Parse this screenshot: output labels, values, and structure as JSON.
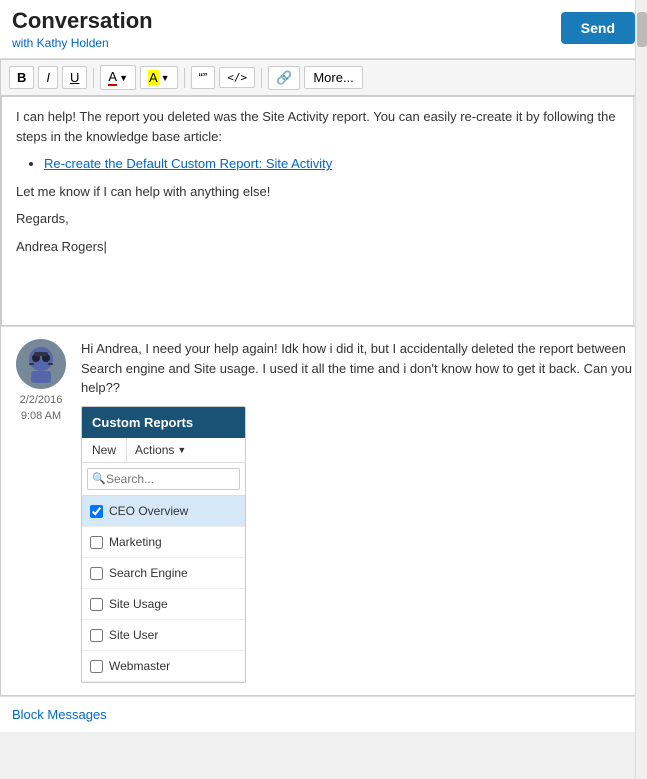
{
  "header": {
    "title": "Conversation",
    "subtitle": "with Kathy Holden",
    "send_label": "Send"
  },
  "toolbar": {
    "bold_label": "B",
    "italic_label": "I",
    "underline_label": "U",
    "font_color_label": "A",
    "highlight_label": "A",
    "quote_label": "“”",
    "code_label": "</>",
    "link_label": "🔗",
    "more_label": "More..."
  },
  "editor": {
    "line1": "I can help! The report you deleted was the Site Activity report. You can easily re-create it by following the steps in the knowledge base article:",
    "link_text": "Re-create the Default Custom Report: Site Activity",
    "line2": "Let me know if I can help with anything else!",
    "signature1": "Regards,",
    "signature2": "Andrea Rogers"
  },
  "customer_message": {
    "timestamp": "2/2/2016\n9:08 AM",
    "text": "Hi Andrea, I need your help again! Idk how i did it, but I accidentally deleted the report between Search engine and Site usage. I used it all the time and i don't know how to get it back. Can you help??"
  },
  "custom_reports_panel": {
    "title": "Custom Reports",
    "new_label": "New",
    "actions_label": "Actions",
    "search_placeholder": "Search...",
    "items": [
      {
        "label": "CEO Overview",
        "selected": true
      },
      {
        "label": "Marketing",
        "selected": false
      },
      {
        "label": "Search Engine",
        "selected": false
      },
      {
        "label": "Site Usage",
        "selected": false
      },
      {
        "label": "Site User",
        "selected": false
      },
      {
        "label": "Webmaster",
        "selected": false
      }
    ]
  },
  "bottom": {
    "block_messages_label": "Block Messages"
  }
}
